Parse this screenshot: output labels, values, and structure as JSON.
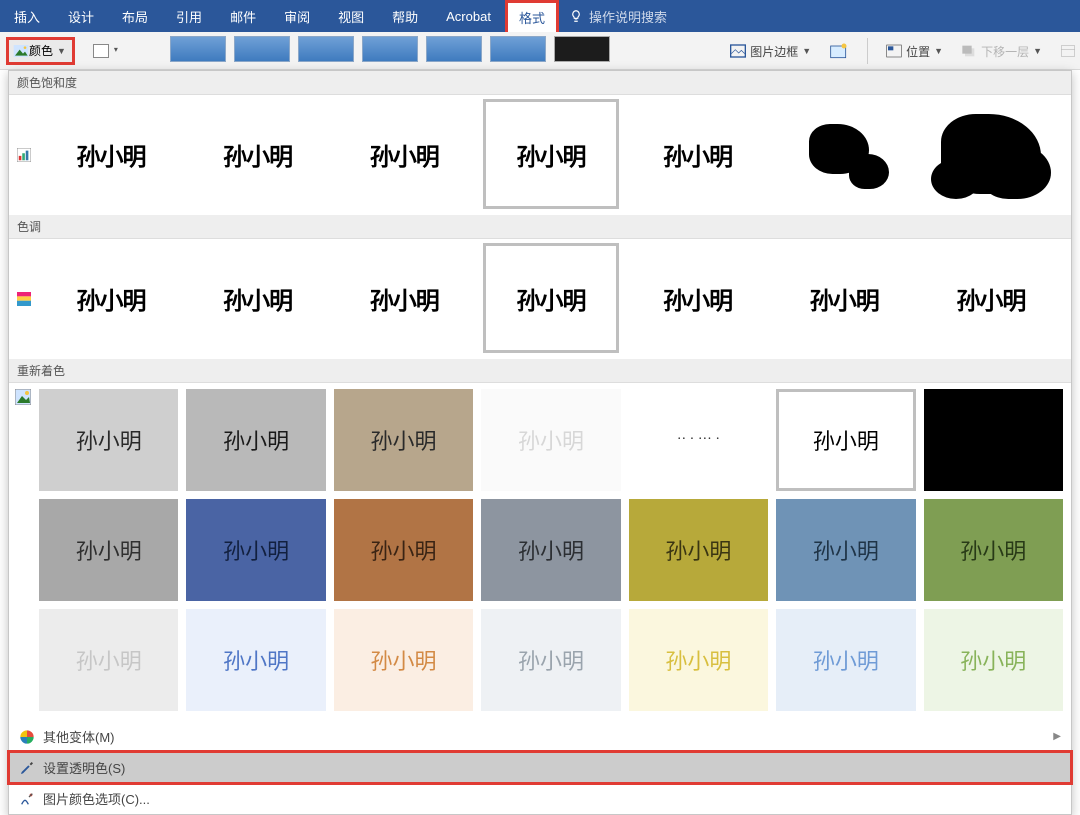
{
  "ribbon": {
    "tabs": [
      "插入",
      "设计",
      "布局",
      "引用",
      "邮件",
      "审阅",
      "视图",
      "帮助",
      "Acrobat",
      "格式"
    ],
    "active_index": 9,
    "tell_me": "操作说明搜索"
  },
  "toolbar": {
    "color_label": "颜色",
    "picture_border": "图片边框",
    "position": "位置",
    "send_backward": "下移一层"
  },
  "panel": {
    "section_saturation": "颜色饱和度",
    "section_tone": "色调",
    "section_recolor": "重新着色",
    "signature_text": "孙小明",
    "saturation_selected_index": 3,
    "tone_selected_index": 3,
    "recolor_selected_index": 5,
    "recolor_tiles": [
      {
        "bg": "#cfcfcf",
        "fg": "#2a2a2a"
      },
      {
        "bg": "#b9b9b9",
        "fg": "#1a1a1a"
      },
      {
        "bg": "#b7a68c",
        "fg": "#2a2a2a"
      },
      {
        "bg": "#fafafa",
        "fg": "#d7d7d7"
      },
      {
        "bg": "#ffffff",
        "fg": "#222222"
      },
      {
        "bg": "#ffffff",
        "fg": "#000000"
      },
      {
        "bg": "#000000",
        "fg": "#000000"
      },
      {
        "bg": "#a8a8a8",
        "fg": "#2f2f2f"
      },
      {
        "bg": "#4a64a4",
        "fg": "#12203f"
      },
      {
        "bg": "#b17445",
        "fg": "#3a2414"
      },
      {
        "bg": "#8d95a0",
        "fg": "#2c2f33"
      },
      {
        "bg": "#b7a93a",
        "fg": "#3a3512"
      },
      {
        "bg": "#6f93b6",
        "fg": "#1f3447"
      },
      {
        "bg": "#7f9e53",
        "fg": "#283a17"
      },
      {
        "bg": "#ececec",
        "fg": "#c6c6c6"
      },
      {
        "bg": "#eaf0fb",
        "fg": "#4f76c6"
      },
      {
        "bg": "#fbeee3",
        "fg": "#d38a45"
      },
      {
        "bg": "#eef1f4",
        "fg": "#9aa4ad"
      },
      {
        "bg": "#fbf7de",
        "fg": "#d8bf3f"
      },
      {
        "bg": "#e6eef8",
        "fg": "#6f9bd6"
      },
      {
        "bg": "#edf5e5",
        "fg": "#88b35a"
      }
    ],
    "footer": {
      "more_variations": "其他变体(M)",
      "set_transparent": "设置透明色(S)",
      "picture_color_options": "图片颜色选项(C)..."
    }
  }
}
